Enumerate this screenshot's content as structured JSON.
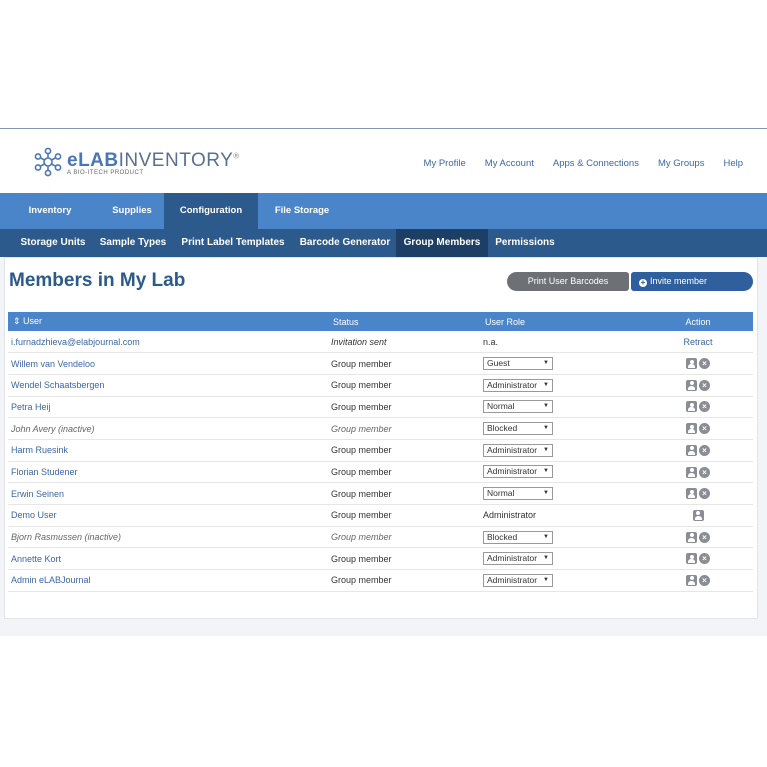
{
  "header": {
    "brand_bold": "eLAB",
    "brand_rest": "INVENTORY",
    "brand_reg": "®",
    "tagline": "A BIO-ITECH PRODUCT",
    "links": [
      "My Profile",
      "My Account",
      "Apps & Connections",
      "My Groups",
      "Help"
    ]
  },
  "mainnav": [
    "Inventory",
    "Supplies",
    "Configuration",
    "File Storage"
  ],
  "subnav": [
    "Storage Units",
    "Sample Types",
    "Print Label Templates",
    "Barcode Generator",
    "Group Members",
    "Permissions"
  ],
  "page": {
    "title": "Members in My Lab",
    "print_button": "Print User Barcodes",
    "invite_button": "Invite member"
  },
  "table": {
    "columns": [
      "⇕ User",
      "Status",
      "User Role",
      "Action"
    ],
    "rows": [
      {
        "user": "i.furnadzhieva@elabjournal.com",
        "status": "Invitation sent",
        "role": "n.a.",
        "role_type": "text",
        "action": "Retract",
        "inactive": false,
        "status_italic": true
      },
      {
        "user": "Willem van Vendeloo",
        "status": "Group member",
        "role": "Guest",
        "role_type": "select",
        "action": "icons",
        "inactive": false
      },
      {
        "user": "Wendel Schaatsbergen",
        "status": "Group member",
        "role": "Administrator",
        "role_type": "select",
        "action": "icons",
        "inactive": false
      },
      {
        "user": "Petra Heij",
        "status": "Group member",
        "role": "Normal",
        "role_type": "select",
        "action": "icons",
        "inactive": false
      },
      {
        "user": "John Avery (inactive)",
        "status": "Group member",
        "role": "Blocked",
        "role_type": "select",
        "action": "icons",
        "inactive": true
      },
      {
        "user": "Harm Ruesink",
        "status": "Group member",
        "role": "Administrator",
        "role_type": "select",
        "action": "icons",
        "inactive": false
      },
      {
        "user": "Florian Studener",
        "status": "Group member",
        "role": "Administrator",
        "role_type": "select",
        "action": "icons",
        "inactive": false
      },
      {
        "user": "Erwin Seinen",
        "status": "Group member",
        "role": "Normal",
        "role_type": "select",
        "action": "icons",
        "inactive": false
      },
      {
        "user": "Demo User",
        "status": "Group member",
        "role": "Administrator",
        "role_type": "text",
        "action": "user-only",
        "inactive": false
      },
      {
        "user": "Bjorn Rasmussen (inactive)",
        "status": "Group member",
        "role": "Blocked",
        "role_type": "select",
        "action": "icons",
        "inactive": true
      },
      {
        "user": "Annette Kort",
        "status": "Group member",
        "role": "Administrator",
        "role_type": "select",
        "action": "icons",
        "inactive": false
      },
      {
        "user": "Admin eLABJournal",
        "status": "Group member",
        "role": "Administrator",
        "role_type": "select",
        "action": "icons",
        "inactive": false
      }
    ]
  },
  "colors": {
    "nav_blue": "#4a84c9",
    "nav_dark": "#2c5a8c",
    "title_blue": "#2c5a8c",
    "link_blue": "#3b67a8"
  },
  "icons": {
    "logo": "molecule-icon",
    "profile": "user-card-icon",
    "remove": "remove-circle-icon",
    "plus": "plus-circle-icon",
    "caret": "caret-down-icon",
    "sort": "sort-icon"
  }
}
